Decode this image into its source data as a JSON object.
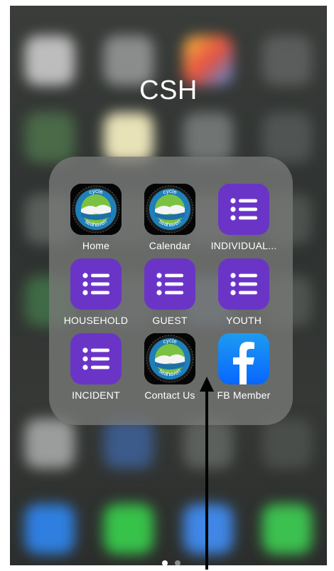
{
  "folder": {
    "title": "CSH",
    "apps": [
      {
        "label": "Home",
        "icon": "cycle-seahaven-logo-icon",
        "logo_text": [
          "cycle",
          "seahaven"
        ]
      },
      {
        "label": "Calendar",
        "icon": "cycle-seahaven-logo-icon",
        "logo_text": [
          "cycle",
          "seahaven"
        ]
      },
      {
        "label": "INDIVIDUAL...",
        "icon": "list-icon"
      },
      {
        "label": "HOUSEHOLD",
        "icon": "list-icon"
      },
      {
        "label": "GUEST",
        "icon": "list-icon"
      },
      {
        "label": "YOUTH",
        "icon": "list-icon"
      },
      {
        "label": "INCIDENT",
        "icon": "list-icon"
      },
      {
        "label": "Contact Us",
        "icon": "cycle-seahaven-logo-icon",
        "logo_text": [
          "cycle",
          "seahaven"
        ]
      },
      {
        "label": "FB Member",
        "icon": "facebook-icon"
      }
    ],
    "page_indicator": {
      "pages": 2,
      "current": 1
    }
  },
  "colors": {
    "forms_purple": "#6a35c7",
    "facebook_blue": "#0866ff",
    "dot_active": "#ffffff",
    "dot_inactive": "rgba(255,255,255,0.45)"
  }
}
